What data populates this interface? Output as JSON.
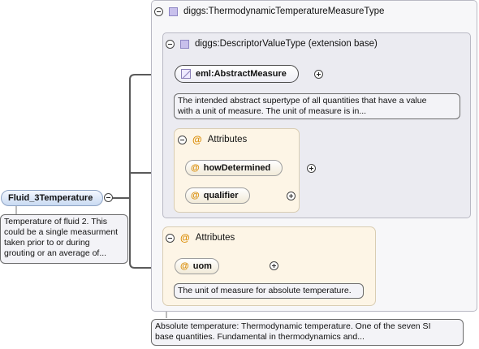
{
  "root_element": {
    "name": "Fluid_3Temperature",
    "documentation": "Temperature of fluid 2. This\ncould be a single measurment\ntaken prior to or during\ngrouting or an average of..."
  },
  "outer_type": {
    "name": "diggs:ThermodynamicTemperatureMeasureType",
    "documentation": "Absolute temperature: Thermodynamic temperature. One of the seven SI\nbase quantities. Fundamental in thermodynamics and..."
  },
  "base_type": {
    "name": "diggs:DescriptorValueType (extension base)"
  },
  "abstract_element": {
    "name": "eml:AbstractMeasure",
    "documentation": "The intended abstract supertype of all quantities that have a value\nwith a unit of measure. The unit of measure is in..."
  },
  "base_attributes": {
    "title": "Attributes",
    "items": [
      {
        "name": "howDetermined"
      },
      {
        "name": "qualifier"
      }
    ]
  },
  "ext_attributes": {
    "title": "Attributes",
    "items": [
      {
        "name": "uom",
        "documentation": "The unit of measure for absolute temperature."
      }
    ]
  },
  "colors": {
    "attribute_at_sign": "#d98a00",
    "type_icon": "#c8c0ec",
    "root_pill": "#c9daf2"
  },
  "icons": [
    "collapse-icon",
    "expand-icon",
    "complex-type-icon",
    "attribute-icon",
    "abstract-element-icon"
  ]
}
